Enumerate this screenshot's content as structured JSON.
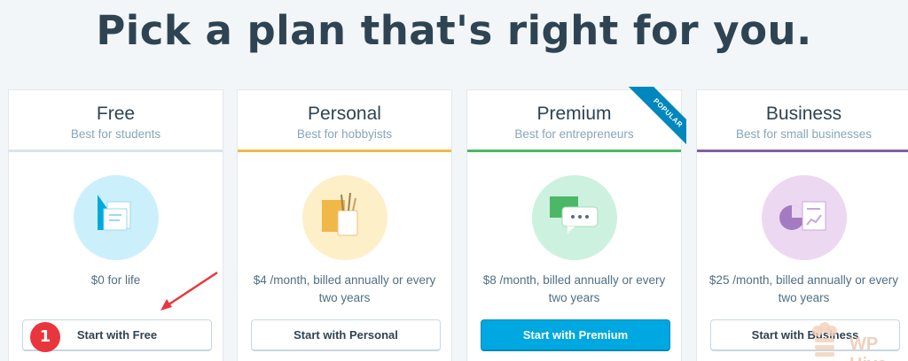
{
  "page": {
    "headline": "Pick a plan that's right for you."
  },
  "plans": [
    {
      "name": "Free",
      "tagline": "Best for students",
      "price": "$0 for life",
      "button": "Start with Free",
      "accent": "#d8e4ea",
      "icon": "free-plan-illustration-icon",
      "icon_bg": "#ccf0fb"
    },
    {
      "name": "Personal",
      "tagline": "Best for hobbyists",
      "price": "$4 /month, billed annually or every two years",
      "button": "Start with Personal",
      "accent": "#f0b849",
      "icon": "personal-plan-illustration-icon",
      "icon_bg": "#fdefc8"
    },
    {
      "name": "Premium",
      "tagline": "Best for entrepreneurs",
      "price": "$8 /month, billed annually or every two years",
      "button": "Start with Premium",
      "accent": "#4ab866",
      "icon": "premium-plan-illustration-icon",
      "icon_bg": "#cdf1df",
      "ribbon": "POPULAR"
    },
    {
      "name": "Business",
      "tagline": "Best for small businesses",
      "price": "$25 /month, billed annually or every two years",
      "button": "Start with Business",
      "accent": "#855da6",
      "icon": "business-plan-illustration-icon",
      "icon_bg": "#ecd9f1"
    }
  ],
  "annotation": {
    "step_number": "1",
    "arrow_color": "#e8363c"
  },
  "watermark": {
    "text": "WP Hive",
    "icon": "hive-logo-icon"
  }
}
